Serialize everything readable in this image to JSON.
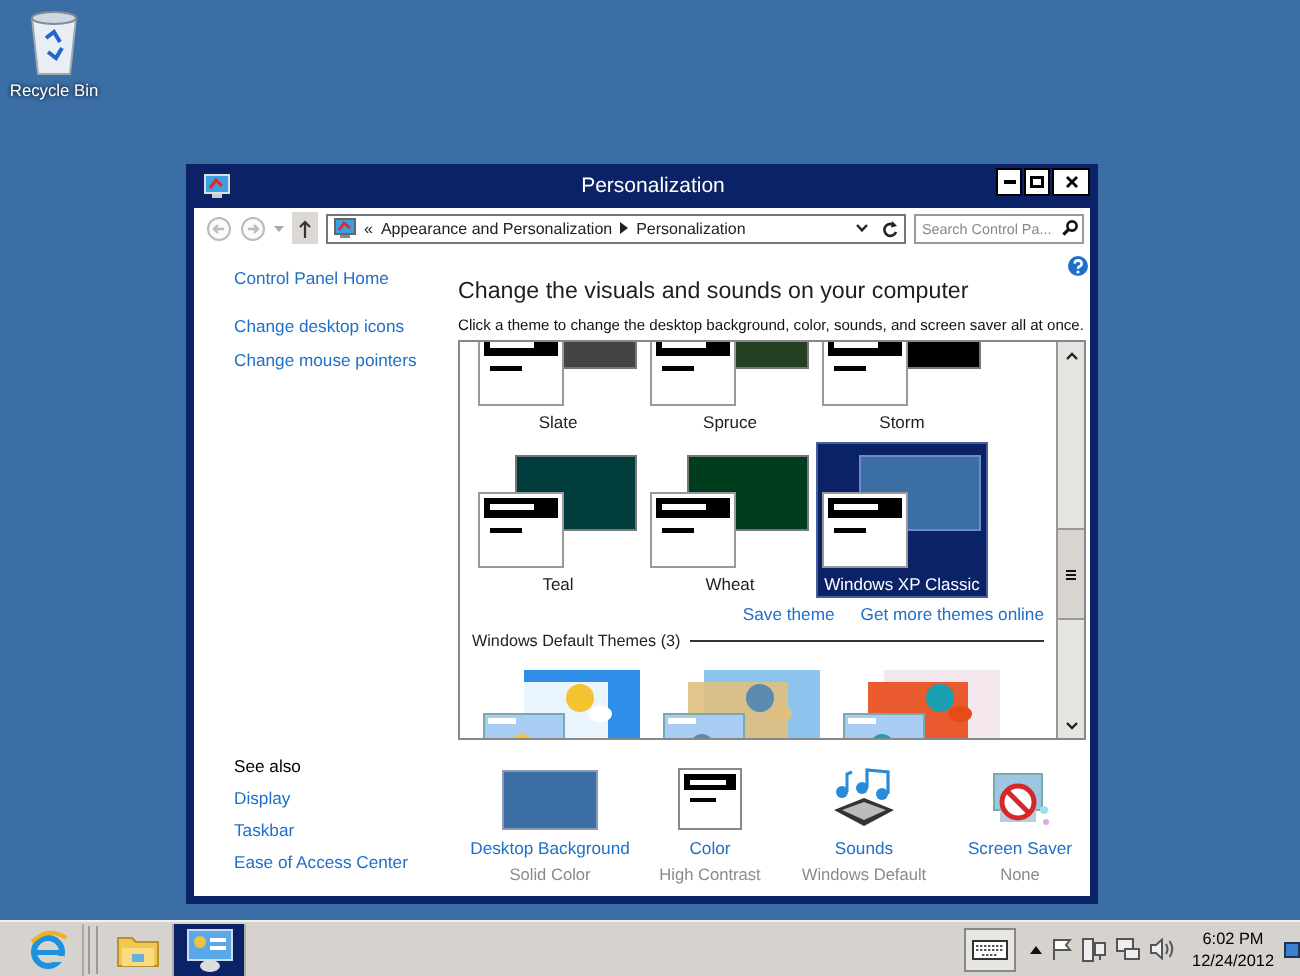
{
  "desktop": {
    "icons": [
      {
        "label": "Recycle Bin"
      }
    ]
  },
  "window": {
    "title": "Personalization",
    "address": {
      "overflow": "«",
      "crumbs": [
        "Appearance and Personalization",
        "Personalization"
      ]
    },
    "search": {
      "placeholder": "Search Control Pa..."
    },
    "sidebar": {
      "links": [
        "Control Panel Home",
        "Change desktop icons",
        "Change mouse pointers"
      ],
      "see_also": {
        "title": "See also",
        "links": [
          "Display",
          "Taskbar",
          "Ease of Access Center"
        ]
      }
    },
    "heading": "Change the visuals and sounds on your computer",
    "subtitle": "Click a theme to change the desktop background, color, sounds, and screen saver all at once.",
    "themes": [
      {
        "name": "Slate",
        "color": "#444444",
        "selected": false
      },
      {
        "name": "Spruce",
        "color": "#243f22",
        "selected": false
      },
      {
        "name": "Storm",
        "color": "#000000",
        "selected": false
      },
      {
        "name": "Teal",
        "color": "#003c3c",
        "selected": false
      },
      {
        "name": "Wheat",
        "color": "#003c1e",
        "selected": false
      },
      {
        "name": "Windows XP Classic",
        "color": "#3a6ea5",
        "selected": true
      }
    ],
    "theme_links": [
      "Save theme",
      "Get more themes online"
    ],
    "default_section": {
      "title": "Windows Default Themes (3)"
    },
    "settings": [
      {
        "kind": "background",
        "label": "Desktop Background",
        "value": "Solid Color"
      },
      {
        "kind": "color",
        "label": "Color",
        "value": "High Contrast"
      },
      {
        "kind": "sounds",
        "label": "Sounds",
        "value": "Windows Default"
      },
      {
        "kind": "screensaver",
        "label": "Screen Saver",
        "value": "None"
      }
    ]
  },
  "taskbar": {
    "apps": [
      {
        "kind": "browser",
        "selected": false
      },
      {
        "kind": "folder",
        "selected": false
      },
      {
        "kind": "control-panel",
        "selected": true
      }
    ],
    "time": "6:02 PM",
    "date": "12/24/2012"
  }
}
